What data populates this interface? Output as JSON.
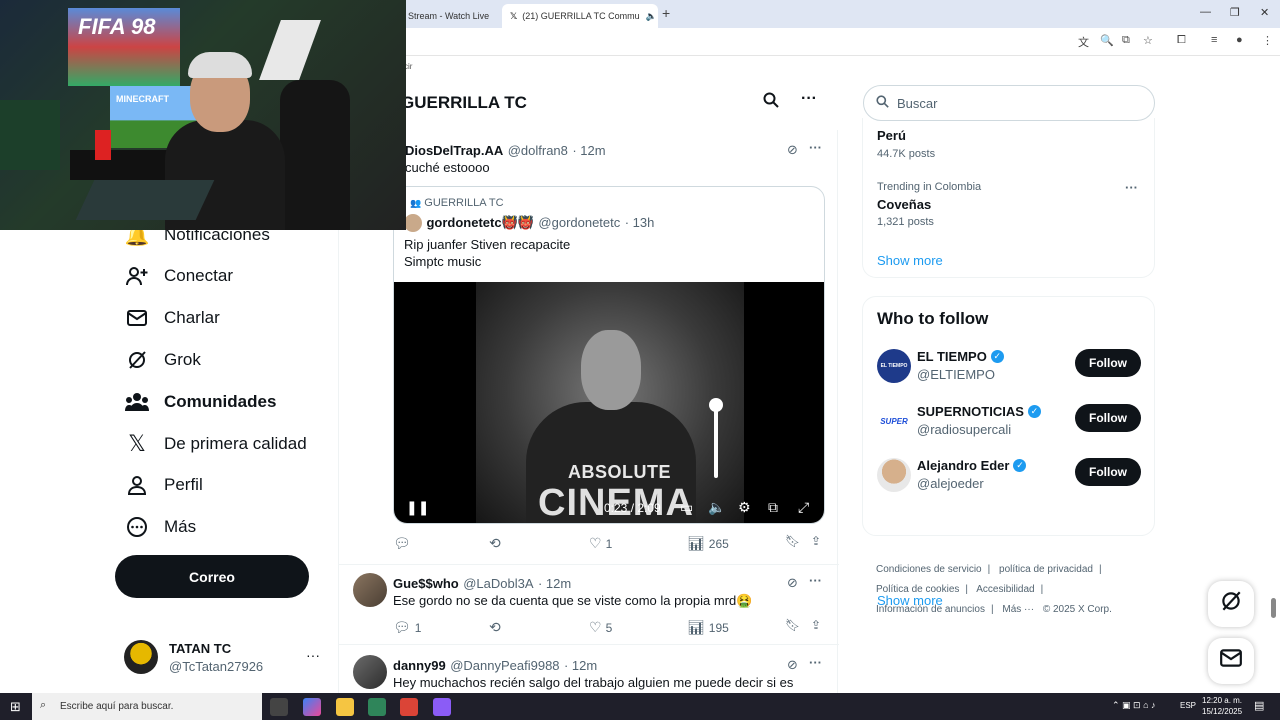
{
  "browser": {
    "tabs": [
      {
        "label": "Stream - Watch Live"
      },
      {
        "label": "(21) GUERRILLA TC Commu"
      }
    ],
    "new_tab": "+",
    "bookmark_fragment": "cir"
  },
  "nav": {
    "items": [
      {
        "label": "Notificaciones",
        "icon": "bell-icon"
      },
      {
        "label": "Conectar",
        "icon": "person-add-icon"
      },
      {
        "label": "Charlar",
        "icon": "mail-icon"
      },
      {
        "label": "Grok",
        "icon": "grok-icon"
      },
      {
        "label": "Comunidades",
        "icon": "communities-icon"
      },
      {
        "label": "De primera calidad",
        "icon": "x-logo-icon"
      },
      {
        "label": "Perfil",
        "icon": "profile-icon"
      },
      {
        "label": "Más",
        "icon": "more-circle-icon"
      }
    ],
    "primary_button": "Correo",
    "account": {
      "name": "TATAN TC",
      "handle": "@TcTatan27926"
    }
  },
  "main": {
    "title": "GUERRILLA TC",
    "posts": [
      {
        "name": "DiosDelTrap.AA",
        "handle": "@dolfran8",
        "time": "· 12m",
        "text": "cuché estoooo",
        "quote": {
          "community": "GUERRILLA TC",
          "name": "gordonetetc👹👹",
          "handle": "@gordonetetc",
          "time": "· 13h",
          "text_line1": "Rip juanfer Stiven recapacite",
          "text_line2": "Simptc music",
          "video": {
            "overlay_line1": "ABSOLUTE",
            "overlay_line2": "CINEMA",
            "time": "0:23 / 2:09"
          }
        },
        "replies": "",
        "reposts": "",
        "likes": "1",
        "views": "265"
      },
      {
        "name": "Gue$$who",
        "handle": "@LaDobl3A",
        "time": "· 12m",
        "text": "Ese gordo no se da cuenta que se viste como la propia mrd🤮",
        "replies": "1",
        "likes": "5",
        "views": "195"
      },
      {
        "name": "danny99",
        "handle": "@DannyPeafi9988",
        "time": "· 12m",
        "text": "Hey muchachos recién salgo del trabajo alguien me puede decir si es"
      }
    ]
  },
  "sidebar": {
    "search_placeholder": "Buscar",
    "trends": [
      {
        "title": "Perú",
        "posts": "44.7K posts"
      },
      {
        "context": "Trending in Colombia",
        "title": "Coveñas",
        "posts": "1,321 posts"
      }
    ],
    "show_more": "Show more",
    "who_to_follow": {
      "title": "Who to follow",
      "follow_label": "Follow",
      "accounts": [
        {
          "name": "EL TIEMPO",
          "handle": "@ELTIEMPO",
          "avatar_color": "#1e3a8a",
          "avatar_text": "EL TIEMPO"
        },
        {
          "name": "SUPERNOTICIAS",
          "handle": "@radiosupercali",
          "avatar_color": "#1d4ed8",
          "avatar_text": "SUPER"
        },
        {
          "name": "Alejandro Eder",
          "handle": "@alejoeder",
          "avatar_color": "#c8a27c",
          "avatar_text": ""
        }
      ],
      "show_more": "Show more"
    },
    "footer": {
      "links": [
        "Condiciones de servicio",
        "|",
        "política de privacidad",
        "|",
        "Política de cookies",
        "|",
        "Accesibilidad",
        "|",
        "Información de anuncios",
        "|",
        "Más ···",
        "© 2025 X Corp."
      ]
    }
  },
  "webcam": {
    "poster_text": "FIFA 98",
    "minecraft_text": "MINECRAFT"
  },
  "taskbar": {
    "search_placeholder": "Escribe aquí para buscar.",
    "language": "ESP",
    "time": "12:20 a. m.",
    "date": "15/12/2025"
  },
  "colors": {
    "accent": "#1d9bf0",
    "text_primary": "#0f1419",
    "text_secondary": "#536471",
    "button_dark": "#0f1419"
  }
}
